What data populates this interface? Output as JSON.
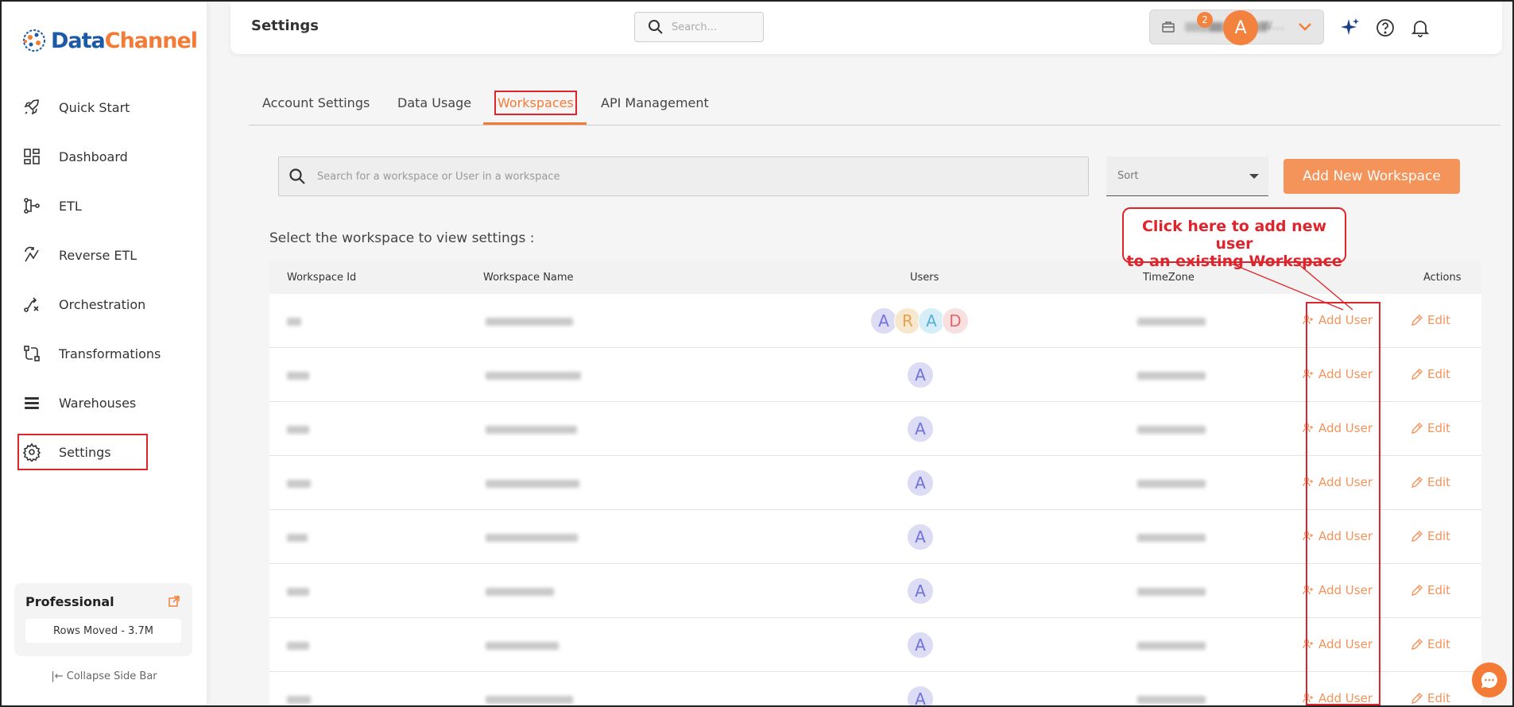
{
  "brand": {
    "name_part1": "Data",
    "name_part2": "Channel"
  },
  "sidebar": {
    "items": [
      {
        "label": "Quick Start",
        "icon": "rocket-icon"
      },
      {
        "label": "Dashboard",
        "icon": "dashboard-icon"
      },
      {
        "label": "ETL",
        "icon": "etl-icon"
      },
      {
        "label": "Reverse ETL",
        "icon": "reverse-etl-icon"
      },
      {
        "label": "Orchestration",
        "icon": "orchestration-icon"
      },
      {
        "label": "Transformations",
        "icon": "transformations-icon"
      },
      {
        "label": "Warehouses",
        "icon": "warehouses-icon"
      },
      {
        "label": "Settings",
        "icon": "gear-icon",
        "active": true
      }
    ],
    "plan": {
      "title": "Professional",
      "rows_moved": "Rows Moved - 3.7M"
    },
    "collapse_label": "Collapse Side Bar"
  },
  "header": {
    "title": "Settings",
    "search_placeholder": "Search...",
    "workspace_label": "W...",
    "notification_count": "2",
    "avatar_initial": "A"
  },
  "tabs": [
    {
      "label": "Account Settings"
    },
    {
      "label": "Data Usage"
    },
    {
      "label": "Workspaces",
      "active": true
    },
    {
      "label": "API Management"
    }
  ],
  "toolbar": {
    "search_placeholder": "Search for a workspace or User in a workspace",
    "sort_label": "Sort",
    "add_workspace_label": "Add New Workspace"
  },
  "select_label": "Select the workspace to view settings :",
  "table": {
    "headers": [
      "Workspace Id",
      "Workspace Name",
      "Users",
      "TimeZone",
      "Actions"
    ],
    "add_user_label": "Add User",
    "edit_label": "Edit",
    "first_row_users": [
      "A",
      "R",
      "A",
      "D"
    ],
    "other_row_user": "A"
  },
  "annotation": {
    "line1": "Click here to add new user",
    "line2": "to an existing Workspace"
  },
  "colors": {
    "accent": "#f47b36",
    "annotation": "#e0242b"
  }
}
